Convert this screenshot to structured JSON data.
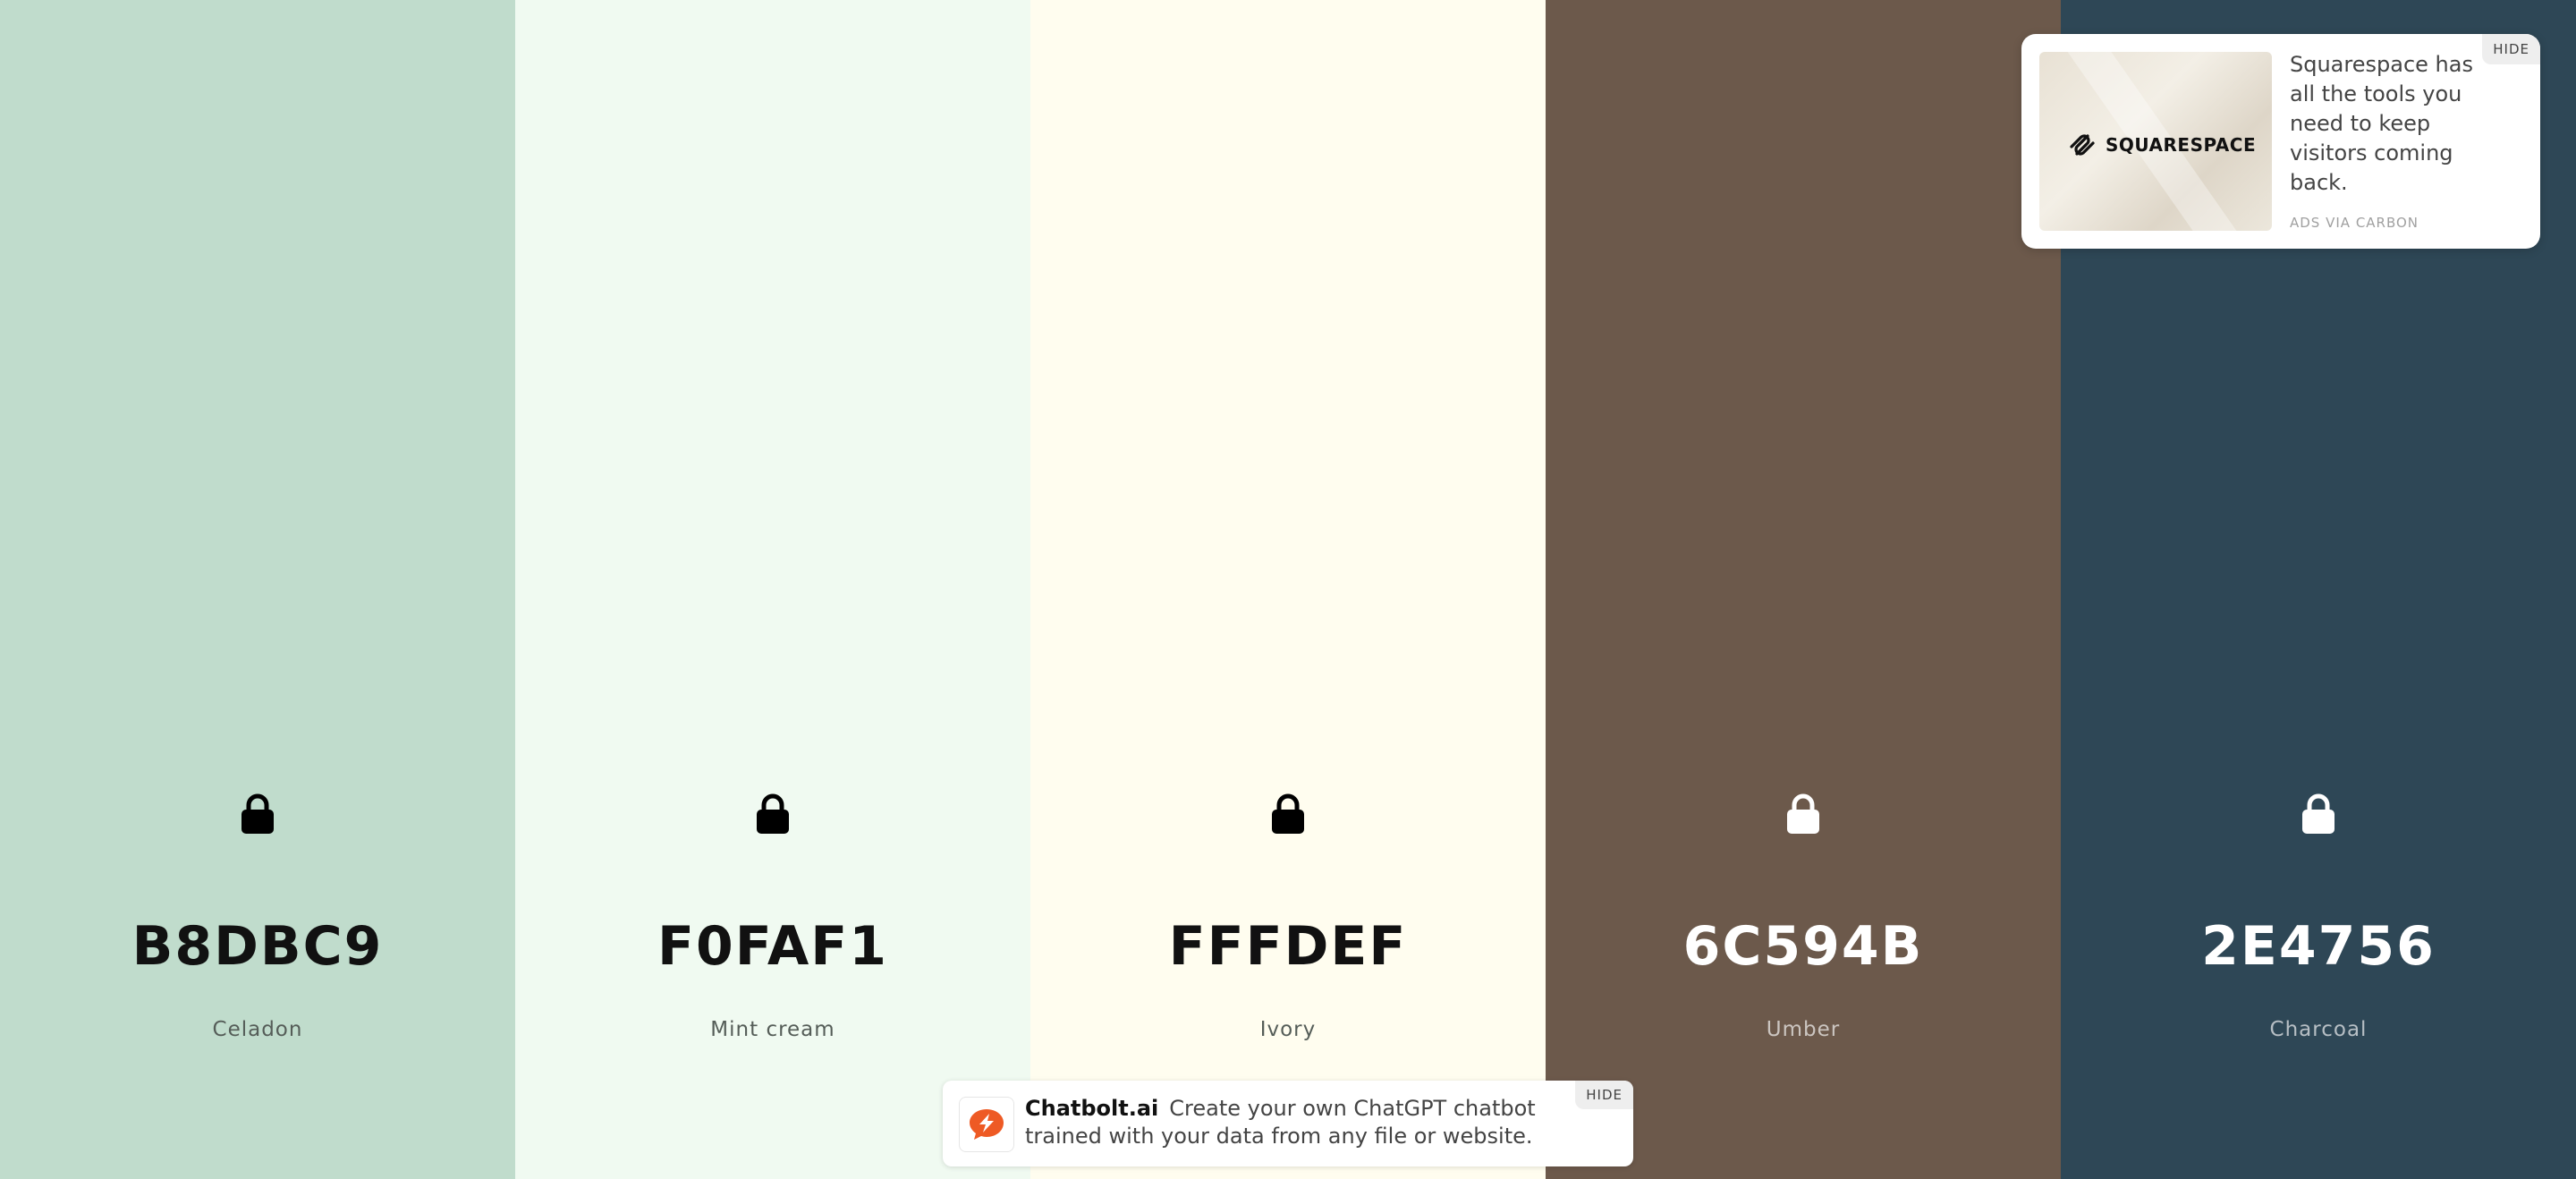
{
  "swatches": [
    {
      "hex": "B8DBC9",
      "name": "Celadon",
      "color": "#c0dccc",
      "text_theme": "dark"
    },
    {
      "hex": "F0FAF1",
      "name": "Mint cream",
      "color": "#f0faf1",
      "text_theme": "dark"
    },
    {
      "hex": "FFFDEF",
      "name": "Ivory",
      "color": "#fffdef",
      "text_theme": "dark"
    },
    {
      "hex": "6C594B",
      "name": "Umber",
      "color": "#6c594b",
      "text_theme": "light"
    },
    {
      "hex": "2E4756",
      "name": "Charcoal",
      "color": "#2e4756",
      "text_theme": "light"
    }
  ],
  "ad": {
    "logo_text": "SQUARESPACE",
    "text": "Squarespace has all the tools you need to keep visitors coming back.",
    "via": "ADS VIA CARBON",
    "hide_label": "HIDE"
  },
  "banner": {
    "brand": "Chatbolt.ai",
    "text": "Create your own ChatGPT chatbot trained with your data from any file or website.",
    "hide_label": "HIDE",
    "icon_color": "#ee5a24"
  }
}
